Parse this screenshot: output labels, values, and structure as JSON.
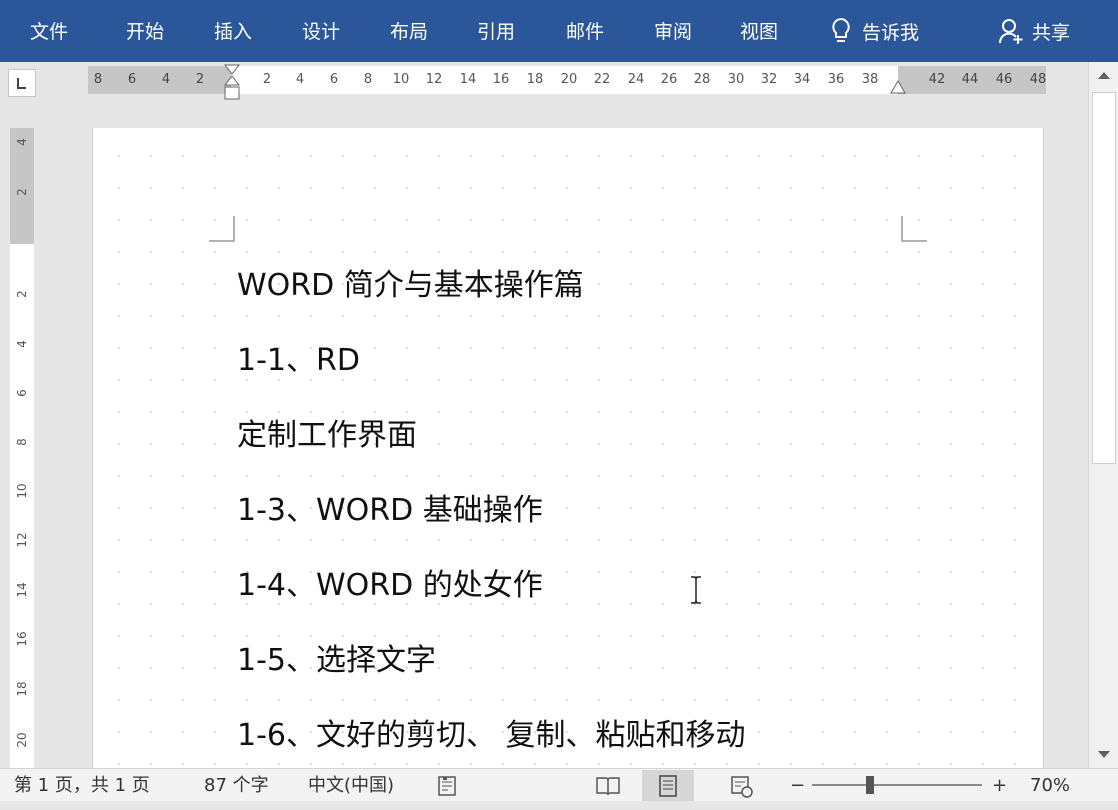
{
  "ribbon": {
    "tabs": [
      "文件",
      "开始",
      "插入",
      "设计",
      "布局",
      "引用",
      "邮件",
      "审阅",
      "视图"
    ],
    "tell_me": "告诉我",
    "share": "共享",
    "color": "#2b579a"
  },
  "ruler": {
    "tab_selector": "L",
    "horizontal_left_gray": [
      "8",
      "6",
      "4",
      "2"
    ],
    "horizontal_main": [
      "2",
      "4",
      "6",
      "8",
      "10",
      "12",
      "14",
      "16",
      "18",
      "20",
      "22",
      "24",
      "26",
      "28",
      "30",
      "32",
      "34",
      "36",
      "38"
    ],
    "horizontal_right_gray": [
      "42",
      "44",
      "46",
      "48"
    ],
    "vertical_top": [
      "4",
      "2"
    ],
    "vertical_main": [
      "2",
      "4",
      "6",
      "8",
      "10",
      "12",
      "14",
      "16",
      "18",
      "20"
    ]
  },
  "document": {
    "lines": [
      "WORD 简介与基本操作篇",
      "1-1、RD",
      "定制工作界面",
      "1-3、WORD 基础操作",
      "1-4、WORD 的处女作",
      "1-5、选择文字",
      "1-6、文好的剪切、 复制、粘贴和移动"
    ]
  },
  "status_bar": {
    "page_info": "第 1 页，共 1 页",
    "word_count": "87 个字",
    "language": "中文(中国)",
    "zoom_minus": "−",
    "zoom_plus": "+",
    "zoom": "70%"
  }
}
